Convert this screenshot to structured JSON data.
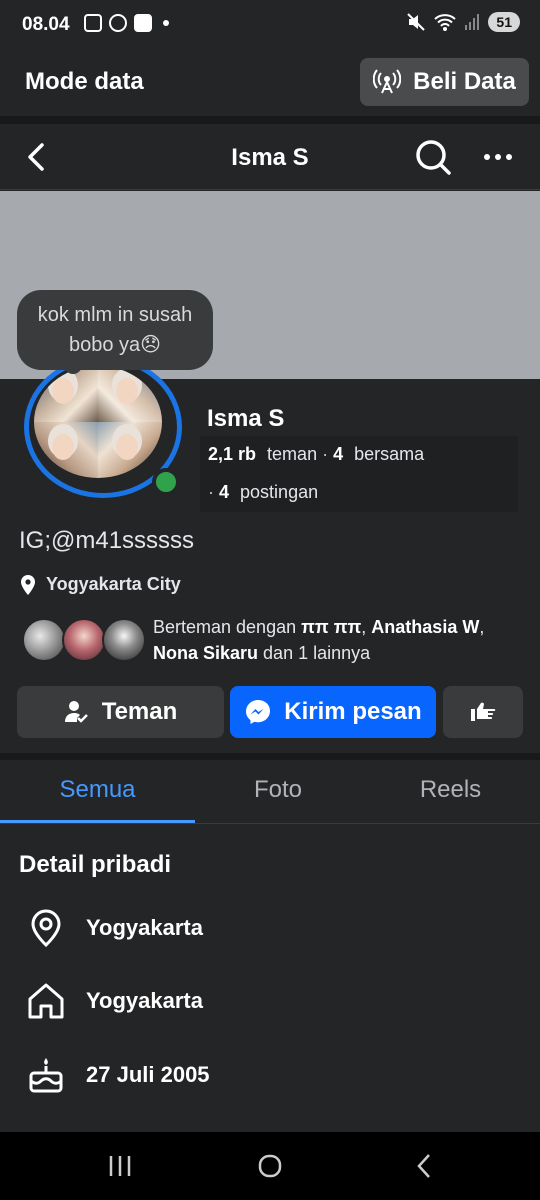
{
  "status_bar": {
    "time": "08.04",
    "battery": "51"
  },
  "data_bar": {
    "title": "Mode data",
    "buy_button": "Beli Data"
  },
  "header": {
    "title": "Isma S"
  },
  "note_bubble": {
    "line1": "kok mlm in susah",
    "line2": "bobo ya😞"
  },
  "profile": {
    "name": "Isma S",
    "friends_count": "2,1 rb",
    "friends_label": "teman",
    "mutual_count": "4",
    "mutual_label": "bersama",
    "posts_count": "4",
    "posts_label": "postingan",
    "bio": "IG;@m41ssssss",
    "location": "Yogyakarta City"
  },
  "mutual_friends": {
    "prefix": "Berteman dengan",
    "friend1": "ππ ππ",
    "sep1": ",",
    "friend2": "Anathasia W",
    "sep2": ",",
    "friend3": "Nona Sikaru",
    "suffix": "dan 1 lainnya"
  },
  "actions": {
    "friends_button": "Teman",
    "message_button": "Kirim pesan"
  },
  "tabs": [
    {
      "label": "Semua",
      "active": true
    },
    {
      "label": "Foto",
      "active": false
    },
    {
      "label": "Reels",
      "active": false
    }
  ],
  "details": {
    "title": "Detail pribadi",
    "items": [
      {
        "icon": "location-pin-icon",
        "value": "Yogyakarta"
      },
      {
        "icon": "home-icon",
        "value": "Yogyakarta"
      },
      {
        "icon": "birthday-cake-icon",
        "value": "27 Juli 2005"
      }
    ]
  },
  "colors": {
    "accent": "#0866ff",
    "tab_active": "#4599ff",
    "online": "#31a24c",
    "background": "#242526"
  }
}
